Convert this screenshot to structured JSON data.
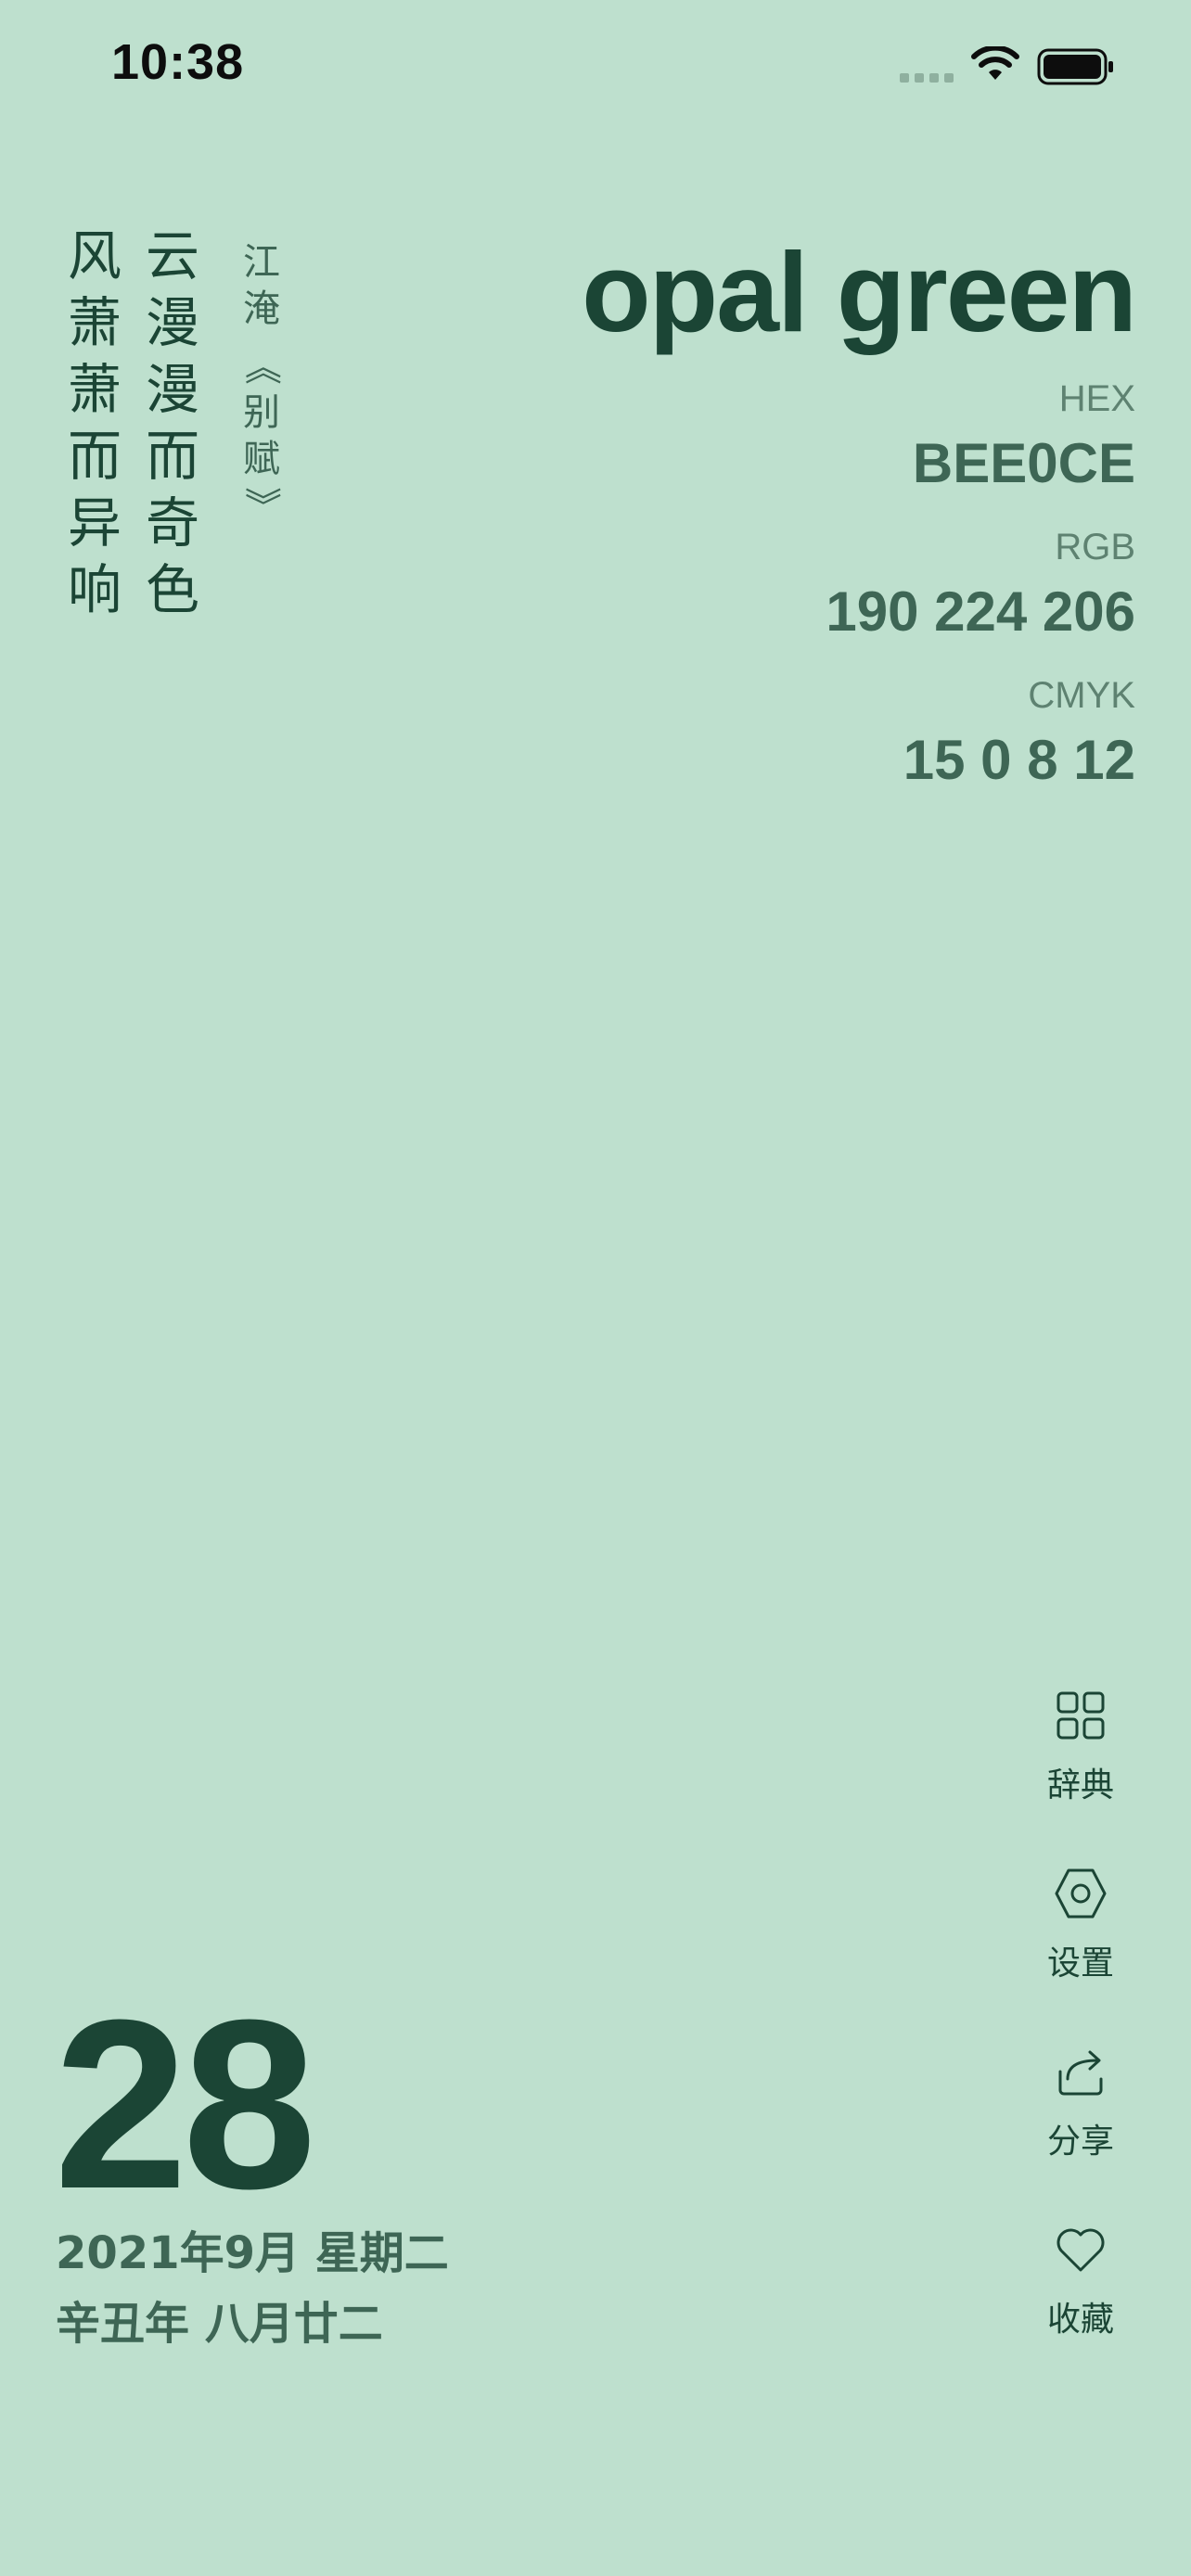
{
  "status_bar": {
    "time": "10:38"
  },
  "poem": {
    "lines": [
      "云漫漫而奇色",
      "风萧萧而异响"
    ],
    "author": "江淹",
    "title": "《别赋》"
  },
  "color": {
    "name": "opal green",
    "hex_label": "HEX",
    "hex_value": "BEE0CE",
    "rgb_label": "RGB",
    "rgb_value": "190 224 206",
    "cmyk_label": "CMYK",
    "cmyk_value": "15 0 8 12",
    "background": "#BEE0CE",
    "text_dark": "#1B4535"
  },
  "date": {
    "day": "28",
    "solar": "2021年9月 星期二",
    "lunar": "辛丑年 八月廿二"
  },
  "menu": {
    "dictionary": "辞典",
    "settings": "设置",
    "share": "分享",
    "favorite": "收藏"
  }
}
